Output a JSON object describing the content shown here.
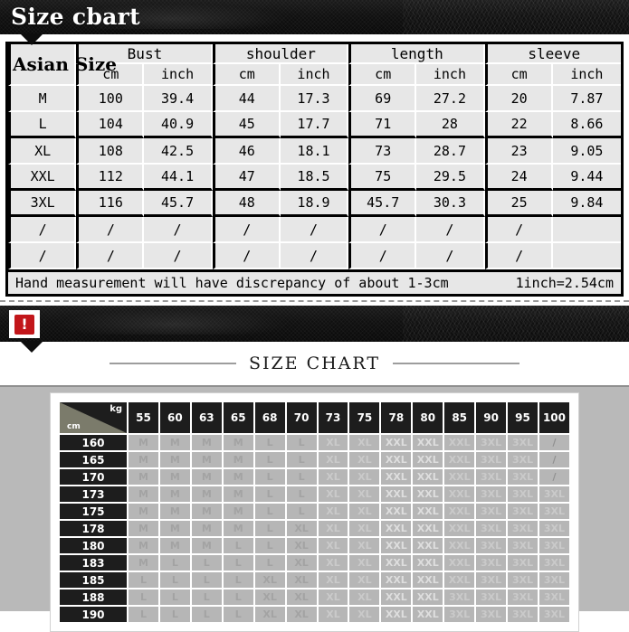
{
  "banner1": {
    "title": "Size cbart"
  },
  "banner2": {
    "icon": "warning-exclamation-icon",
    "icon_glyph": "!"
  },
  "size_table": {
    "row_header_label": "Asian Size",
    "measurements": [
      "Bust",
      "shoulder",
      "length",
      "sleeve"
    ],
    "units": [
      "cm",
      "inch"
    ],
    "rows": [
      {
        "size": "M",
        "values": [
          "100",
          "39.4",
          "44",
          "17.3",
          "69",
          "27.2",
          "20",
          "7.87"
        ]
      },
      {
        "size": "L",
        "values": [
          "104",
          "40.9",
          "45",
          "17.7",
          "71",
          "28",
          "22",
          "8.66"
        ]
      },
      {
        "size": "XL",
        "values": [
          "108",
          "42.5",
          "46",
          "18.1",
          "73",
          "28.7",
          "23",
          "9.05"
        ]
      },
      {
        "size": "XXL",
        "values": [
          "112",
          "44.1",
          "47",
          "18.5",
          "75",
          "29.5",
          "24",
          "9.44"
        ]
      },
      {
        "size": "3XL",
        "values": [
          "116",
          "45.7",
          "48",
          "18.9",
          "45.7",
          "30.3",
          "25",
          "9.84"
        ]
      },
      {
        "size": "/",
        "values": [
          "/",
          "/",
          "/",
          "/",
          "/",
          "/",
          "/",
          ""
        ]
      },
      {
        "size": "/",
        "values": [
          "/",
          "/",
          "/",
          "/",
          "/",
          "/",
          "/",
          ""
        ]
      }
    ],
    "footer_note": "Hand measurement will have discrepancy of about 1-3cm",
    "footer_conversion": "1inch=2.54cm"
  },
  "size_chart_heading": {
    "title": "SIZE CHART"
  },
  "chart_data": {
    "type": "table",
    "title": "SIZE CHART",
    "xlabel": "kg",
    "ylabel": "cm",
    "corner_kg": "kg",
    "corner_cm": "cm",
    "categories": [
      "55",
      "60",
      "63",
      "65",
      "68",
      "70",
      "73",
      "75",
      "78",
      "80",
      "85",
      "90",
      "95",
      "100"
    ],
    "heights": [
      "160",
      "165",
      "170",
      "173",
      "175",
      "178",
      "180",
      "183",
      "185",
      "188",
      "190"
    ],
    "rows": [
      {
        "height": "160",
        "values": [
          "M",
          "M",
          "M",
          "M",
          "L",
          "L",
          "XL",
          "XL",
          "XXL",
          "XXL",
          "XXL",
          "3XL",
          "3XL",
          "/"
        ]
      },
      {
        "height": "165",
        "values": [
          "M",
          "M",
          "M",
          "M",
          "L",
          "L",
          "XL",
          "XL",
          "XXL",
          "XXL",
          "XXL",
          "3XL",
          "3XL",
          "/"
        ]
      },
      {
        "height": "170",
        "values": [
          "M",
          "M",
          "M",
          "M",
          "L",
          "L",
          "XL",
          "XL",
          "XXL",
          "XXL",
          "XXL",
          "3XL",
          "3XL",
          "/"
        ]
      },
      {
        "height": "173",
        "values": [
          "M",
          "M",
          "M",
          "M",
          "L",
          "L",
          "XL",
          "XL",
          "XXL",
          "XXL",
          "XXL",
          "3XL",
          "3XL",
          "3XL"
        ]
      },
      {
        "height": "175",
        "values": [
          "M",
          "M",
          "M",
          "M",
          "L",
          "L",
          "XL",
          "XL",
          "XXL",
          "XXL",
          "XXL",
          "3XL",
          "3XL",
          "3XL"
        ]
      },
      {
        "height": "178",
        "values": [
          "M",
          "M",
          "M",
          "M",
          "L",
          "XL",
          "XL",
          "XL",
          "XXL",
          "XXL",
          "XXL",
          "3XL",
          "3XL",
          "3XL"
        ]
      },
      {
        "height": "180",
        "values": [
          "M",
          "M",
          "M",
          "L",
          "L",
          "XL",
          "XL",
          "XL",
          "XXL",
          "XXL",
          "XXL",
          "3XL",
          "3XL",
          "3XL"
        ]
      },
      {
        "height": "183",
        "values": [
          "M",
          "L",
          "L",
          "L",
          "L",
          "XL",
          "XL",
          "XL",
          "XXL",
          "XXL",
          "XXL",
          "3XL",
          "3XL",
          "3XL"
        ]
      },
      {
        "height": "185",
        "values": [
          "L",
          "L",
          "L",
          "L",
          "XL",
          "XL",
          "XL",
          "XL",
          "XXL",
          "XXL",
          "XXL",
          "3XL",
          "3XL",
          "3XL"
        ]
      },
      {
        "height": "188",
        "values": [
          "L",
          "L",
          "L",
          "L",
          "XL",
          "XL",
          "XL",
          "XL",
          "XXL",
          "XXL",
          "3XL",
          "3XL",
          "3XL",
          "3XL"
        ]
      },
      {
        "height": "190",
        "values": [
          "L",
          "L",
          "L",
          "L",
          "XL",
          "XL",
          "XL",
          "XL",
          "XXL",
          "XXL",
          "3XL",
          "3XL",
          "3XL",
          "3XL"
        ]
      }
    ],
    "colors": {
      "header_bg": "#1d1d1d",
      "cell_bg": "#b6b6b6",
      "corner_lower": "#7b7b6b",
      "accent_red": "#c2161a"
    }
  }
}
